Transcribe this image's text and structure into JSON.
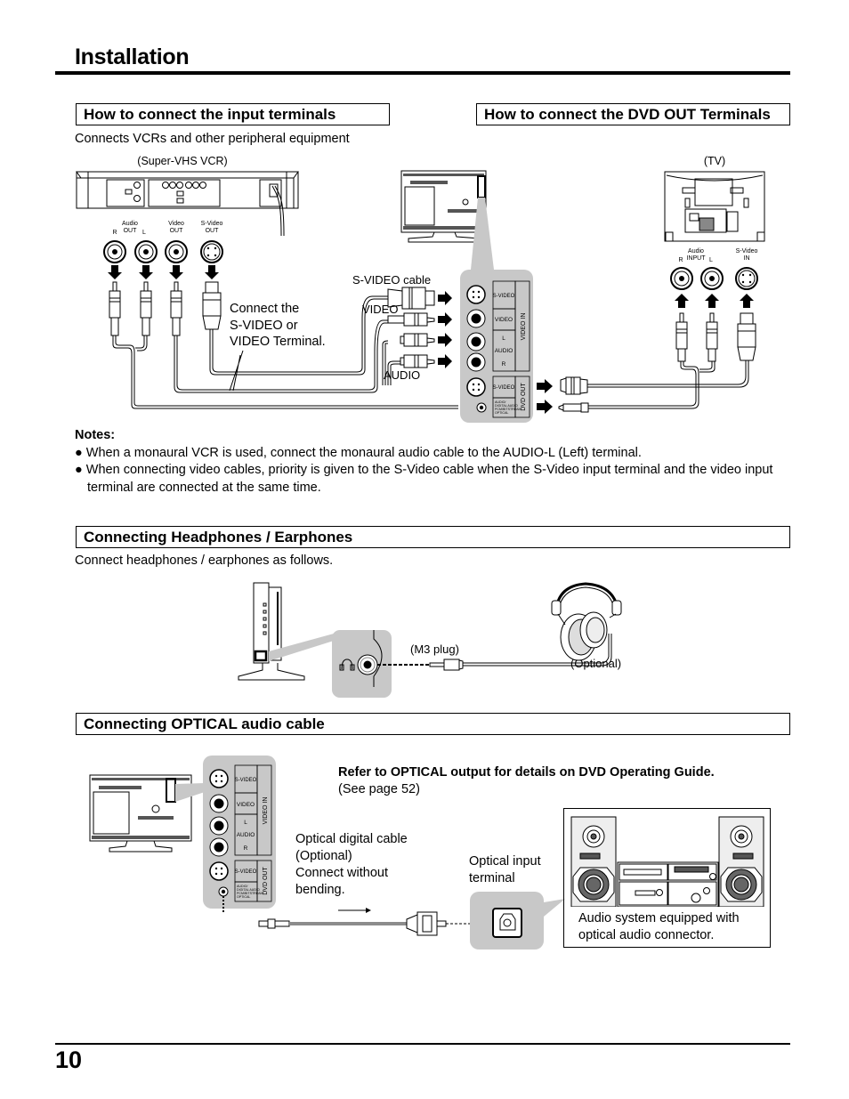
{
  "page": {
    "title": "Installation",
    "page_number": "10"
  },
  "input_section": {
    "heading": "How to connect the input terminals",
    "subtitle": "Connects VCRs and other peripheral equipment",
    "vcr_label": "(Super-VHS VCR)",
    "vcr_jacks": {
      "audio_label": "Audio",
      "out": "OUT",
      "r": "R",
      "l": "L",
      "video_label": "Video",
      "video_out": "OUT",
      "svideo_label": "S-Video",
      "svideo_out": "OUT"
    },
    "callout": "Connect the\nS-VIDEO or\nVIDEO Terminal.",
    "callout_lines": [
      "Connect the",
      "S-VIDEO or",
      "VIDEO Terminal."
    ],
    "cable_labels": {
      "svideo_cable": "S-VIDEO cable",
      "video": "VIDEO",
      "audio": "AUDIO"
    }
  },
  "panel": {
    "svideo_in": "S-VIDEO",
    "video": "VIDEO",
    "audio_l": "L",
    "audio": "AUDIO",
    "audio_r": "R",
    "video_in": "VIDEO IN",
    "svideo_out": "S-VIDEO",
    "optical_lines": [
      "AUDIO/",
      "DIGITAL AUDIO",
      "PCM/BITSTREAM",
      "OPTICAL"
    ],
    "dvd_out": "DVD OUT"
  },
  "dvd_out_section": {
    "heading": "How to connect the DVD OUT Terminals",
    "tv_label": "(TV)",
    "tv_jacks": {
      "audio_label": "Audio",
      "input": "INPUT",
      "r": "R",
      "l": "L",
      "svideo_label": "S-Video",
      "in": "IN"
    }
  },
  "notes": {
    "heading": "Notes:",
    "bullet": "●",
    "items": [
      "When a monaural VCR is used, connect the monaural audio cable to the AUDIO-L (Left) terminal.",
      "When connecting video cables, priority is given to the S-Video cable when the S-Video input terminal and the video input terminal are connected at the same time."
    ]
  },
  "headphones_section": {
    "heading": "Connecting Headphones / Earphones",
    "subtitle": "Connect headphones / earphones as follows.",
    "plug_label": "(M3 plug)",
    "optional_label": "(Optional)"
  },
  "optical_section": {
    "heading": "Connecting OPTICAL audio cable",
    "refer_bold": "Refer to OPTICAL output for details on DVD Operating Guide.",
    "refer_page": "(See page 52)",
    "cable_lines": [
      "Optical digital cable",
      "(Optional)",
      "Connect without",
      "bending."
    ],
    "input_terminal_lines": [
      "Optical input",
      "terminal"
    ],
    "audio_system_lines": [
      "Audio system equipped with",
      "optical audio connector."
    ]
  },
  "colors": {
    "panel_gray": "#c8c8c8",
    "callout_gray": "#b4b4b4",
    "cable_gray": "#8c8c8c",
    "ink": "#000000"
  }
}
